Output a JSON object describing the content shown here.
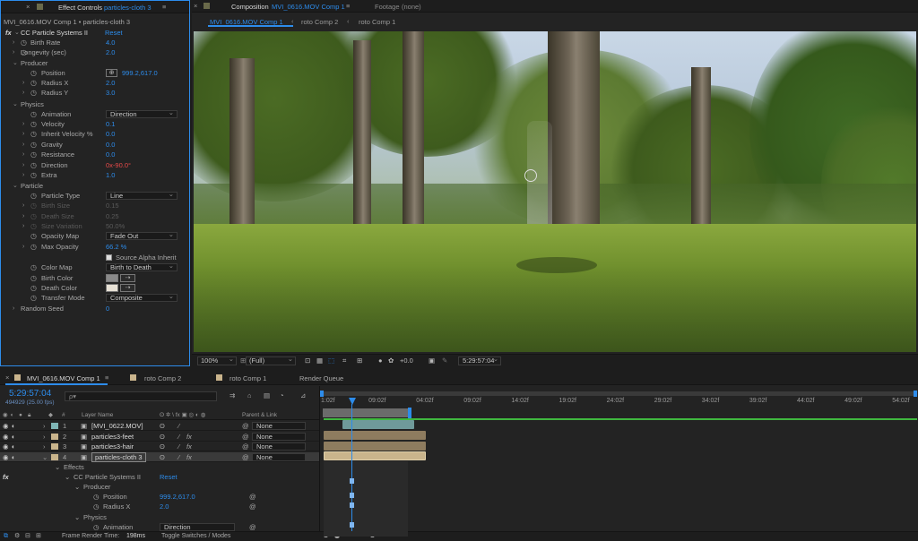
{
  "effect_controls": {
    "tab_close": "×",
    "tab_title": "Effect Controls",
    "tab_target": "particles-cloth 3",
    "menu_icon": "≡",
    "breadcrumb": "MVI_0616.MOV Comp 1 • particles-cloth 3",
    "effect_name": "CC Particle Systems II",
    "reset_label": "Reset",
    "fx_label": "fx",
    "props": {
      "birth_rate": {
        "label": "Birth Rate",
        "value": "4.0"
      },
      "longevity": {
        "label": "Longevity (sec)",
        "value": "2.0"
      },
      "producer": {
        "label": "Producer"
      },
      "position": {
        "label": "Position",
        "value": "999.2,617.0"
      },
      "radius_x": {
        "label": "Radius X",
        "value": "2.0"
      },
      "radius_y": {
        "label": "Radius Y",
        "value": "3.0"
      },
      "physics": {
        "label": "Physics"
      },
      "animation": {
        "label": "Animation",
        "value": "Direction"
      },
      "velocity": {
        "label": "Velocity",
        "value": "0.1"
      },
      "inherit_velocity": {
        "label": "Inherit Velocity %",
        "value": "0.0"
      },
      "gravity": {
        "label": "Gravity",
        "value": "0.0"
      },
      "resistance": {
        "label": "Resistance",
        "value": "0.0"
      },
      "direction": {
        "label": "Direction",
        "value": "0x-90.0°"
      },
      "extra": {
        "label": "Extra",
        "value": "1.0"
      },
      "particle": {
        "label": "Particle"
      },
      "particle_type": {
        "label": "Particle Type",
        "value": "Line"
      },
      "birth_size": {
        "label": "Birth Size",
        "value": "0.15"
      },
      "death_size": {
        "label": "Death Size",
        "value": "0.25"
      },
      "size_variation": {
        "label": "Size Variation",
        "value": "50.0%"
      },
      "opacity_map": {
        "label": "Opacity Map",
        "value": "Fade Out"
      },
      "max_opacity": {
        "label": "Max Opacity",
        "value": "66.2 %"
      },
      "source_alpha": {
        "label": "Source Alpha Inherit"
      },
      "color_map": {
        "label": "Color Map",
        "value": "Birth to Death"
      },
      "birth_color": {
        "label": "Birth Color",
        "color": "#8a8a8a"
      },
      "death_color": {
        "label": "Death Color",
        "color": "#e8e2d6"
      },
      "transfer_mode": {
        "label": "Transfer Mode",
        "value": "Composite"
      },
      "random_seed": {
        "label": "Random Seed",
        "value": "0"
      }
    }
  },
  "composition": {
    "tab_close": "×",
    "tab_title": "Composition",
    "tab_target": "MVI_0616.MOV Comp 1",
    "menu_icon": "≡",
    "footage_label": "Footage",
    "footage_value": "(none)",
    "subtabs": [
      "MVI_0616.MOV Comp 1",
      "roto Comp 2",
      "roto Comp 1"
    ],
    "zoom": "100%",
    "resolution": "(Full)",
    "exposure": "+0.0",
    "timecode": "5:29:57:04"
  },
  "timeline": {
    "tabs": [
      "MVI_0616.MOV Comp 1",
      "roto Comp 2",
      "roto Comp 1",
      "Render Queue"
    ],
    "current_time": "5:29:57:04",
    "frame_info": "494929 (25.00 fps)",
    "search_placeholder": "ρ▾",
    "col_layer_name": "Layer Name",
    "col_parent": "Parent & Link",
    "ruler": [
      "1:02f",
      "09:02f",
      "04:02f",
      "09:02f",
      "14:02f",
      "19:02f",
      "24:02f",
      "29:02f",
      "34:02f",
      "39:02f",
      "44:02f",
      "49:02f",
      "54:02f"
    ],
    "layers": [
      {
        "num": "1",
        "name": "[MVI_0622.MOV]",
        "parent": "None",
        "label_color": "#7fb5b5"
      },
      {
        "num": "2",
        "name": "particles3-feet",
        "parent": "None",
        "label_color": "#c9b48c"
      },
      {
        "num": "3",
        "name": "particles3-hair",
        "parent": "None",
        "label_color": "#c9b48c"
      },
      {
        "num": "4",
        "name": "particles-cloth 3",
        "parent": "None",
        "label_color": "#c9b48c"
      }
    ],
    "sub": {
      "effects": "Effects",
      "effect_name": "CC Particle Systems II",
      "reset": "Reset",
      "producer": "Producer",
      "position_label": "Position",
      "position_value": "999.2,617.0",
      "radius_label": "Radius X",
      "radius_value": "2.0",
      "physics": "Physics",
      "animation_label": "Animation",
      "animation_value": "Direction"
    },
    "footer": {
      "render_label": "Frame Render Time:",
      "render_value": "198ms",
      "toggle_label": "Toggle Switches / Modes"
    }
  }
}
